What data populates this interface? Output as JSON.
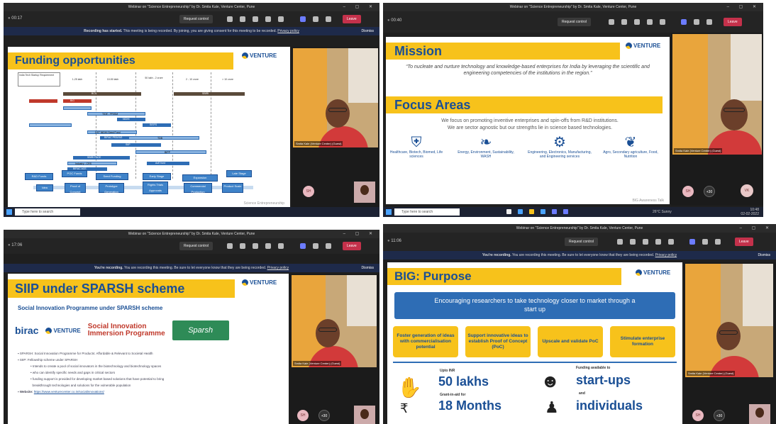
{
  "q1": {
    "window_title": "Webinar on \"Science Entrepreneurship\" by Dr. Smita Kale, Venture Center, Pune",
    "time": "00:17",
    "request_control": "Request control",
    "leave": "Leave",
    "banner_title": "Recording has started.",
    "banner_text": "This meeting is being recorded. By joining, you are giving consent for this meeting to be recorded.",
    "banner_link": "Privacy policy",
    "dismiss": "Dismiss",
    "slide_title": "Funding opportunities",
    "logo": "VENTURE",
    "logo_sub": "CENTER",
    "table_header": "India Tech Startup Requirement",
    "stage_cols": [
      "1-25 lakh",
      "10-50 lakh",
      "50 lakh - 2 crore",
      "2 - 10 crore",
      "> 10 crore"
    ],
    "bar_labels": [
      "BCIL",
      "SBIRI",
      "BIG",
      "TIDE - PRISM",
      "NIDHI",
      "BIRAC PRAYAS",
      "SISFS",
      "DST NIDHI Seed Fund",
      "TDB",
      "SIIP",
      "BIPP",
      "SBIRI PACE",
      "Industry - CRS",
      "BIRAC ACE",
      "AcE fund"
    ],
    "steps": [
      "R&D Funds",
      "POC Funds",
      "Seed Funding",
      "Early Stage",
      "Expansion",
      "Late Stage"
    ],
    "stages": [
      "Idea",
      "Proof of Concept",
      "Prototype Generation",
      "Rights Trials Approvals",
      "Commercial Production",
      "Product Scale"
    ],
    "footer": "Science Entrepreneurship",
    "participant_caption": "Smita Kale (Venture Center) (Guest)",
    "avatar": "SH"
  },
  "q2": {
    "window_title": "Webinar on \"Science Entrepreneurship\" by Dr. Smita Kale, Venture Center, Pune",
    "time": "00:40",
    "request_control": "Request control",
    "leave": "Leave",
    "mission_title": "Mission",
    "mission_text": "“To nucleate and nurture technology and knowledge-based enterprises for India by leveraging the scientific and engineering competencies of the institutions in the region.”",
    "focus_title": "Focus Areas",
    "focus_text_1": "We focus on promoting inventive enterprises and spin-offs from R&D institutions.",
    "focus_text_2": "We are sector agnostic but our strengths lie in science based technologies.",
    "areas": [
      {
        "icon": "shield-plus-icon",
        "label": "Healthcare, Biotech, Biomed, Life sciences"
      },
      {
        "icon": "leaf-icon",
        "label": "Energy, Environment, Sustainability, WASH"
      },
      {
        "icon": "gears-icon",
        "label": "Engineering, Electronics, Manufacturing, and Engineering services"
      },
      {
        "icon": "tree-icon",
        "label": "Agro, Secondary agriculture, Food, Nutrition"
      }
    ],
    "footer": "BIG Awareness Talk",
    "participant_caption": "Smita Kale (Venture Center) (Guest)",
    "avatar_sh": "SH",
    "avatar_plus": "+30",
    "avatar_vk": "VK",
    "taskbar_search": "Type here to search",
    "weather": "26°C Sunny",
    "clock_time": "10:48",
    "clock_date": "02-02-2022"
  },
  "q3": {
    "window_title": "Webinar on \"Science Entrepreneurship\" by Dr. Smita Kale, Venture Center, Pune",
    "time": "17:06",
    "request_control": "Request control",
    "leave": "Leave",
    "banner_title": "You're recording.",
    "banner_text": "You are recording this meeting. Be sure to let everyone know that they are being recorded.",
    "banner_link": "Privacy policy",
    "dismiss": "Dismiss",
    "slide_title": "SIIP under SPARSH scheme",
    "subtitle": "Social Innovation Programme under SPARSH scheme",
    "birac": "birac",
    "sii_1": "Social Innovation",
    "sii_2": "Immersion Programme",
    "sparsh": "Sparsh",
    "bullets": [
      "SPARSH: Social Innovation Programme for Products: Affordable & Relevant to Societal Health",
      "SIIP: Fellowship scheme under SPARSH",
      "Intends to create a pool of social innovators in the biotechnology and biotechnology spaces",
      "who can identify specific needs and gaps in critical sectors",
      "funding support is provided for developing market based solutions that have potential to bring",
      "breakthrough technologies and solutions for the vulnerable population"
    ],
    "website_label": "Website:",
    "website": "https://www.venturecenter.co.in/socialinnovations/",
    "participant_caption": "Smita Kale (Venture Center) (Guest)",
    "avatar_sh": "SH",
    "avatar_plus": "+30"
  },
  "q4": {
    "window_title": "Webinar on \"Science Entrepreneurship\" by Dr. Smita Kale, Venture Center, Pune",
    "time": "11:06",
    "request_control": "Request control",
    "leave": "Leave",
    "banner_title": "You're recording.",
    "banner_text": "You are recording this meeting. Be sure to let everyone know that they are being recorded.",
    "banner_link": "Privacy policy",
    "dismiss": "Dismiss",
    "slide_title": "BIG: Purpose",
    "purpose": "Encouraging researchers to take technology closer to market through a start up",
    "boxes": [
      "Foster generation of ideas with commercialisation potential",
      "Support innovative ideas to establish Proof of Concept (PoC)",
      "Upscale and validate PoC",
      "Stimulate enterprise formation"
    ],
    "upto": "Upto INR",
    "amount": "50 lakhs",
    "grant": "Grant-in-aid for",
    "months": "18 Months",
    "funding_avail": "Funding available to",
    "startups": "start-ups",
    "and": "and",
    "individuals": "individuals",
    "participant_caption": "Smita Kale (Venture Center) (Guest)",
    "avatar_sh": "SH",
    "avatar_plus": "+30"
  },
  "colors": {
    "yellow": "#f7c21b",
    "blue": "#1a4f95",
    "leave_red": "#c4314b",
    "teams_purple": "#6c7cff"
  }
}
